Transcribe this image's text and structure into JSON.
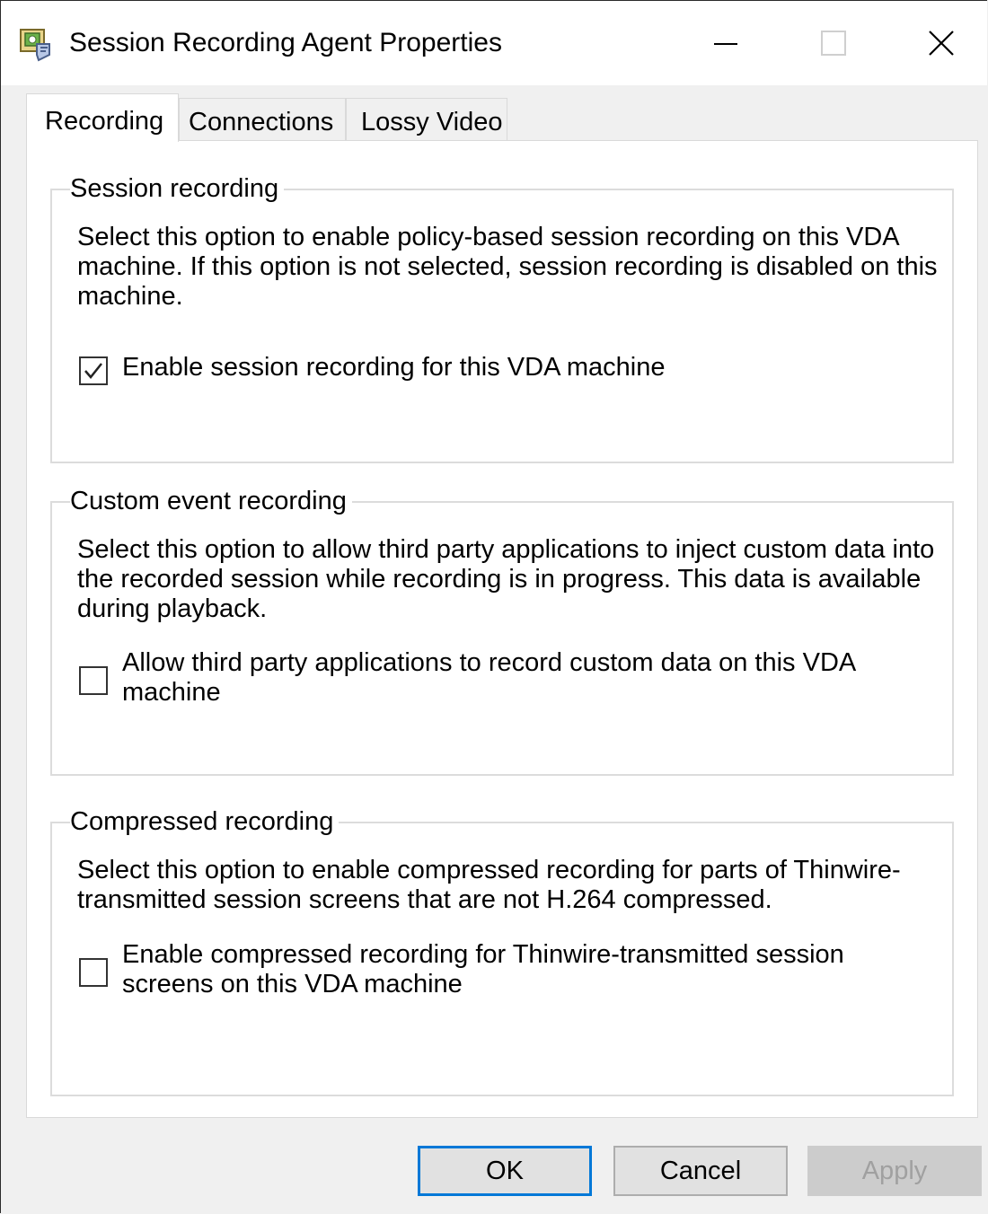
{
  "window": {
    "title": "Session Recording Agent Properties",
    "app_icon": "session-recording-agent-icon",
    "controls": [
      "minimize-icon",
      "maximize-icon",
      "close-icon"
    ]
  },
  "tabs": [
    {
      "label": "Recording",
      "active": true
    },
    {
      "label": "Connections",
      "active": false
    },
    {
      "label": "Lossy Video",
      "active": false
    }
  ],
  "groups": {
    "session_recording": {
      "title": "Session recording",
      "description": "Select this option to enable policy-based session recording on this VDA machine. If this option is not selected, session recording is disabled on this machine.",
      "checkbox_label": "Enable session recording for this VDA machine",
      "checked": true
    },
    "custom_event": {
      "title": "Custom event recording",
      "description": "Select this option to allow third party applications to inject custom data into the recorded session while recording is in progress. This data is available during playback.",
      "checkbox_label": "Allow third party applications to record custom data on this VDA machine",
      "checked": false
    },
    "compressed": {
      "title": "Compressed recording",
      "description": "Select this option to enable compressed recording for parts of Thinwire-transmitted session screens that are not H.264 compressed.",
      "checkbox_label": "Enable compressed recording for Thinwire-transmitted session screens on this VDA machine",
      "checked": false
    }
  },
  "buttons": {
    "ok": "OK",
    "cancel": "Cancel",
    "apply": "Apply"
  },
  "colors": {
    "default_button_border": "#0078d7",
    "disabled_text": "#a0a0a0"
  }
}
